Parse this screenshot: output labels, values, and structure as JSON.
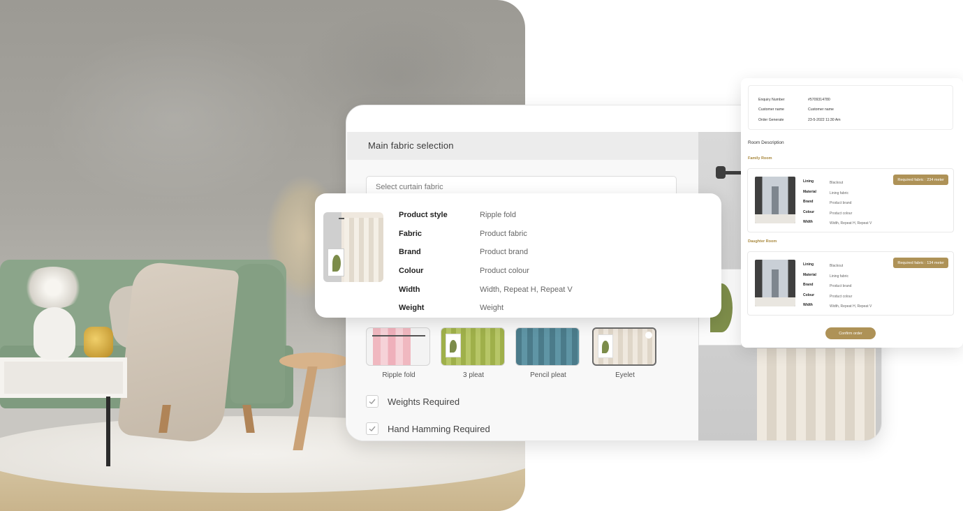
{
  "fabric_form": {
    "title": "Main fabric selection",
    "select_placeholder": "Select curtain fabric",
    "styles": [
      {
        "label": "Ripple fold",
        "selected": false
      },
      {
        "label": "3 pleat",
        "selected": false
      },
      {
        "label": "Pencil pleat",
        "selected": false
      },
      {
        "label": "Eyelet",
        "selected": true
      }
    ],
    "checkboxes": [
      {
        "label": "Weights Required",
        "checked": true
      },
      {
        "label": "Hand Hamming Required",
        "checked": true
      }
    ]
  },
  "product_detail": {
    "rows": [
      {
        "key": "Product style",
        "value": "Ripple fold"
      },
      {
        "key": "Fabric",
        "value": "Product fabric"
      },
      {
        "key": "Brand",
        "value": "Product brand"
      },
      {
        "key": "Colour",
        "value": "Product colour"
      },
      {
        "key": "Width",
        "value": "Width, Repeat H, Repeat V"
      },
      {
        "key": "Weight",
        "value": "Weight"
      }
    ]
  },
  "order": {
    "info": [
      {
        "key": "Enquiry Number",
        "value": "#5709314780"
      },
      {
        "key": "Customer name",
        "value": "Customer name"
      },
      {
        "key": "Order Generate",
        "value": "23-5-2022  11:30 Am"
      }
    ],
    "section_title": "Room Description",
    "rooms": [
      {
        "name": "Family Room",
        "badge": "Required fabric :  234 meter",
        "specs": [
          {
            "key": "Lining",
            "value": "Blackout"
          },
          {
            "key": "Material",
            "value": "Lining fabric"
          },
          {
            "key": "Brand",
            "value": "Product brand"
          },
          {
            "key": "Colour",
            "value": "Product colour"
          },
          {
            "key": "Width",
            "value": "Width, Repeat H, Repeat V"
          }
        ]
      },
      {
        "name": "Daughter Room",
        "badge": "Required fabric :  134 meter",
        "specs": [
          {
            "key": "Lining",
            "value": "Blackout"
          },
          {
            "key": "Material",
            "value": "Lining fabric"
          },
          {
            "key": "Brand",
            "value": "Product brand"
          },
          {
            "key": "Colour",
            "value": "Product colour"
          },
          {
            "key": "Width",
            "value": "Width, Repeat H, Repeat V"
          }
        ]
      }
    ],
    "confirm_label": "Confirm order"
  },
  "colors": {
    "accent": "#ae9257",
    "panel": "#f8f8f8",
    "header": "#ececec"
  }
}
